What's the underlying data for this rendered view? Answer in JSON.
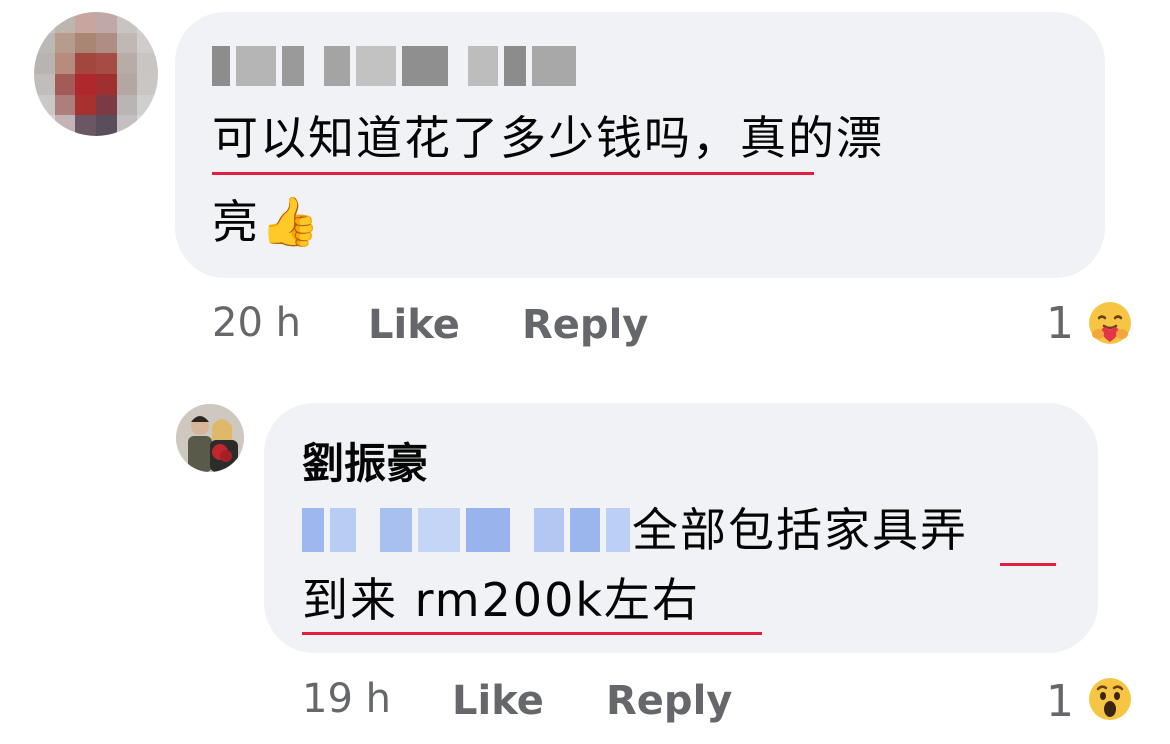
{
  "comment": {
    "text_line1": "可以知道花了多少钱吗，真的漂",
    "text_line2": "亮",
    "thumbs_emoji": "👍",
    "time": "20 h",
    "like_label": "Like",
    "reply_label": "Reply",
    "reaction_count": "1",
    "reaction_icon": "care-reaction-icon"
  },
  "reply": {
    "author": "劉振豪",
    "text_line1_suffix": "全部包括家具弄",
    "text_line2": "到来 rm200k左右",
    "time": "19 h",
    "like_label": "Like",
    "reply_label": "Reply",
    "reaction_count": "1",
    "reaction_icon": "wow-reaction-icon"
  },
  "colors": {
    "bubble": "#f0f2f5",
    "meta_text": "#65676b",
    "spellcheck_underline": "#e41e3f",
    "mention_blur": "#a9c2f0"
  }
}
